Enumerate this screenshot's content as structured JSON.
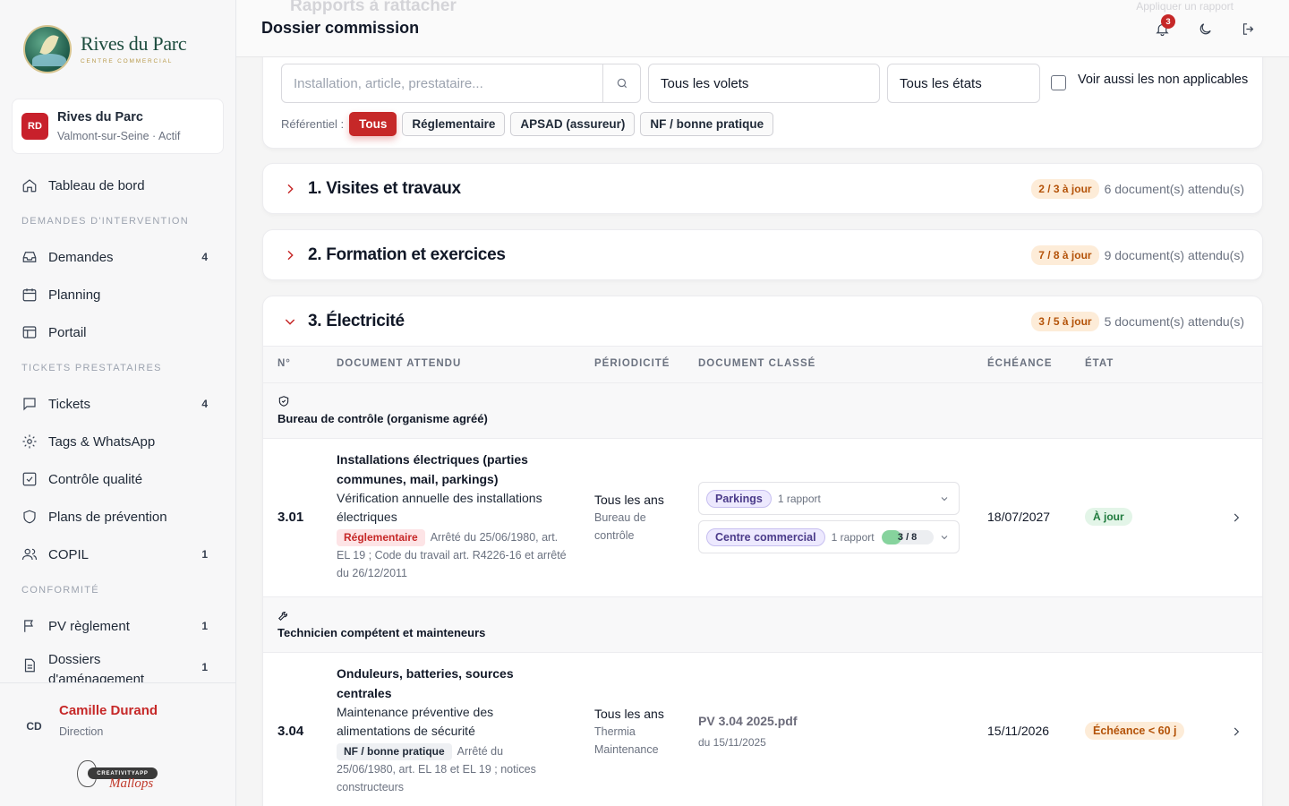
{
  "brand": {
    "title": "Rives du Parc",
    "subtitle": "CENTRE COMMERCIAL"
  },
  "site": {
    "initials": "RD",
    "name": "Rives du Parc",
    "location": "Valmont-sur-Seine · Actif"
  },
  "nav": {
    "dashboard": "Tableau de bord",
    "section_interventions": "DEMANDES D'INTERVENTION",
    "demandes": {
      "label": "Demandes",
      "count": "4"
    },
    "planning": "Planning",
    "portail": "Portail",
    "section_tickets": "TICKETS PRESTATAIRES",
    "tickets": {
      "label": "Tickets",
      "count": "4"
    },
    "tags": "Tags & WhatsApp",
    "qualite": "Contrôle qualité",
    "prevention": "Plans de prévention",
    "copil": {
      "label": "COPIL",
      "count": "1"
    },
    "section_conformite": "CONFORMITÉ",
    "pv": {
      "label": "PV règlement",
      "count": "1"
    },
    "dossiers": {
      "label": "Dossiers d'aménagement",
      "count": "1"
    }
  },
  "user": {
    "initials": "CD",
    "name": "Camille Durand",
    "role": "Direction"
  },
  "footer_brand": {
    "pill": "CREATIVITYAPP",
    "script": "Mallops"
  },
  "header": {
    "title": "Dossier commission",
    "ghost_title": "Rapports à rattacher",
    "ghost_action": "Appliquer un rapport",
    "notif_count": "3"
  },
  "filters": {
    "search_placeholder": "Installation, article, prestataire...",
    "volets": "Tous les volets",
    "etats": "Tous les états",
    "show_na": "Voir aussi les non applicables",
    "ref_label": "Référentiel :",
    "chips": [
      "Tous",
      "Réglementaire",
      "APSAD (assureur)",
      "NF / bonne pratique"
    ]
  },
  "sections": [
    {
      "title": "1. Visites et travaux",
      "badge": "2 / 3 à jour",
      "docs": "6 document(s) attendu(s)"
    },
    {
      "title": "2. Formation et exercices",
      "badge": "7 / 8 à jour",
      "docs": "9 document(s) attendu(s)"
    },
    {
      "title": "3. Électricité",
      "badge": "3 / 5 à jour",
      "docs": "5 document(s) attendu(s)"
    }
  ],
  "table": {
    "headers": [
      "N°",
      "DOCUMENT ATTENDU",
      "PÉRIODICITÉ",
      "DOCUMENT CLASSÉ",
      "ÉCHÉANCE",
      "ÉTAT"
    ],
    "group1": "Bureau de contrôle (organisme agréé)",
    "row1": {
      "no": "3.01",
      "title": "Installations électriques (parties communes, mail, parkings)",
      "desc": "Vérification annuelle des installations électriques",
      "tag": "Réglementaire",
      "ref": "Arrêté du 25/06/1980, art. EL 19 ; Code du travail art. R4226-16 et arrêté du 26/12/2011",
      "period": "Tous les ans",
      "period_sub": "Bureau de contrôle",
      "docs": [
        {
          "zone": "Parkings",
          "count": "1 rapport"
        },
        {
          "zone": "Centre commercial",
          "count": "1 rapport",
          "progress": "3 / 8",
          "progress_value": 0.375
        }
      ],
      "due": "18/07/2027",
      "status": "À jour"
    },
    "group2": "Technicien compétent et mainteneurs",
    "row2": {
      "no": "3.04",
      "title": "Onduleurs, batteries, sources centrales",
      "desc": "Maintenance préventive des alimentations de sécurité",
      "tag": "NF / bonne pratique",
      "ref": "Arrêté du 25/06/1980, art. EL 18 et EL 19 ; notices constructeurs",
      "period": "Tous les ans",
      "period_sub": "Thermia Maintenance",
      "file": "PV 3.04 2025.pdf",
      "file_date": "du 15/11/2025",
      "due": "15/11/2026",
      "status": "Échéance < 60 j"
    }
  }
}
